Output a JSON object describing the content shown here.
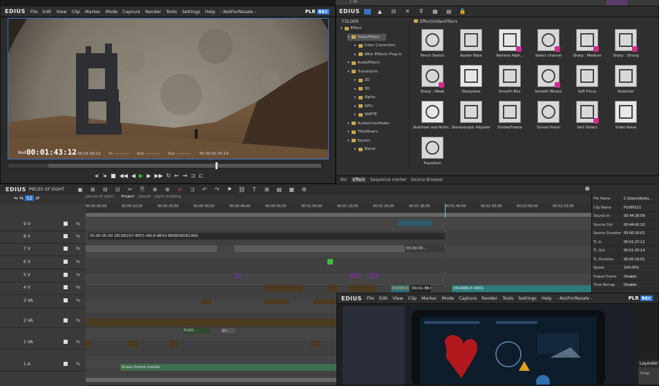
{
  "player": {
    "menus": [
      "File",
      "Edit",
      "View",
      "Clip",
      "Marker",
      "Mode",
      "Capture",
      "Render",
      "Tools",
      "Settings",
      "Help"
    ],
    "title": "- NotForResale -",
    "plr": "PLR",
    "rec": "REC",
    "timecode": "00:01:43:12",
    "tc_label": "Rod",
    "cur_label": "Cur",
    "cur": "00:01:43:12",
    "in_label": "In",
    "in": "--:--:--:--",
    "out_label": "Out",
    "out": "--:--:--:--",
    "dur_label": "Dur",
    "dur": "--:--:--:--",
    "ttl_label": "Ttl",
    "ttl": "00:02:47:14"
  },
  "effects": {
    "folder_label": "FOLDER",
    "path": "Effect/VideoFilters",
    "tree": [
      {
        "label": "Effect",
        "depth": 0
      },
      {
        "label": "VideoFilters",
        "depth": 1,
        "selected": true
      },
      {
        "label": "Color Correction",
        "depth": 2
      },
      {
        "label": "After Effects Plug-in",
        "depth": 2
      },
      {
        "label": "AudioFilters",
        "depth": 1
      },
      {
        "label": "Transitions",
        "depth": 1
      },
      {
        "label": "2D",
        "depth": 2
      },
      {
        "label": "3D",
        "depth": 2
      },
      {
        "label": "Alpha",
        "depth": 2
      },
      {
        "label": "GPU",
        "depth": 2
      },
      {
        "label": "SMPTE",
        "depth": 2
      },
      {
        "label": "AudioCrossFades",
        "depth": 1
      },
      {
        "label": "TitleMixers",
        "depth": 1
      },
      {
        "label": "Keyers",
        "depth": 1
      },
      {
        "label": "Blend",
        "depth": 2
      }
    ],
    "items": [
      "Pencil Sketch",
      "Raster Wipe",
      "Remove Alph...",
      "Select channel",
      "Sharp : Medium",
      "Sharp : Strong",
      "Sharp : Weak",
      "Sharpness",
      "Smooth Blur",
      "Smooth Mosaic",
      "Soft Focus",
      "Stabilizer",
      "Stabilizer and Rollin...",
      "Stereoscopic Adjuster",
      "Strobe/Freeze",
      "Tunnel Vision",
      "Vert Detect",
      "Video Noise",
      "Transform"
    ],
    "tabs": [
      "Bin",
      "Effect",
      "Sequence marker",
      "Source Browser"
    ]
  },
  "timeline": {
    "logo": "EDIUS",
    "project": "PIECES OF EIGHT",
    "seq_tabs": [
      "pieces of eight...",
      "Project",
      "planet",
      "eight building"
    ],
    "ruler": [
      "00:00:00;00",
      "00:00:10;00",
      "00:00:20;00",
      "00:00:30;00",
      "00:00:40;00",
      "00:00:50;00",
      "00:01:00;00",
      "00:01:10;00",
      "00:01:20;00",
      "00:01:30;00",
      "00:01:40;00",
      "00:01:50;00",
      "00:02:00;00",
      "00:02:10;00"
    ],
    "tracks": [
      "9 V",
      "8 V",
      "7 V",
      "6 V",
      "5 V",
      "4 V",
      "3 VA",
      "2 VA",
      "1 VA",
      "1 A"
    ],
    "clip8v": "00.00.00.00 2EC6E237-4EF2-49CA-8E43-869839D8136D",
    "clip7v": "00.00.00...",
    "clip_p": "P1000111",
    "clip_tc": "00:01:38:01",
    "clip_date": "20140617-0001",
    "clip2va": "P100...",
    "clip2va_b": "pl...",
    "audio_clip": "Grass theme master"
  },
  "props": {
    "rows": [
      [
        "File Name",
        "C:\\Users\\Kosta..."
      ],
      [
        "Clip Name",
        "P1000111"
      ],
      [
        "Source In",
        "00:44:26:09"
      ],
      [
        "Source Out",
        "00:44:42:10"
      ],
      [
        "Source Duration",
        "00:00:16:01"
      ],
      [
        "TL In",
        "00:01:27:12"
      ],
      [
        "TL Out",
        "00:01:43:14"
      ],
      [
        "TL Duration",
        "00:00:16:01"
      ],
      [
        "Speed",
        "100.00%"
      ],
      [
        "Freeze Frame",
        "Disable"
      ],
      [
        "Time Remap",
        "Disable"
      ]
    ]
  },
  "second": {
    "logo": "EDIUS",
    "menus": [
      "File",
      "Edit",
      "View",
      "Clip",
      "Marker",
      "Mode",
      "Capture",
      "Render",
      "Tools",
      "Settings",
      "Help"
    ],
    "title": "- NotForResale -",
    "plr": "PLR",
    "rec": "REC",
    "layouter": "Layouter",
    "crop": "Crop"
  },
  "topstrip": {
    "label": "1 VA"
  }
}
